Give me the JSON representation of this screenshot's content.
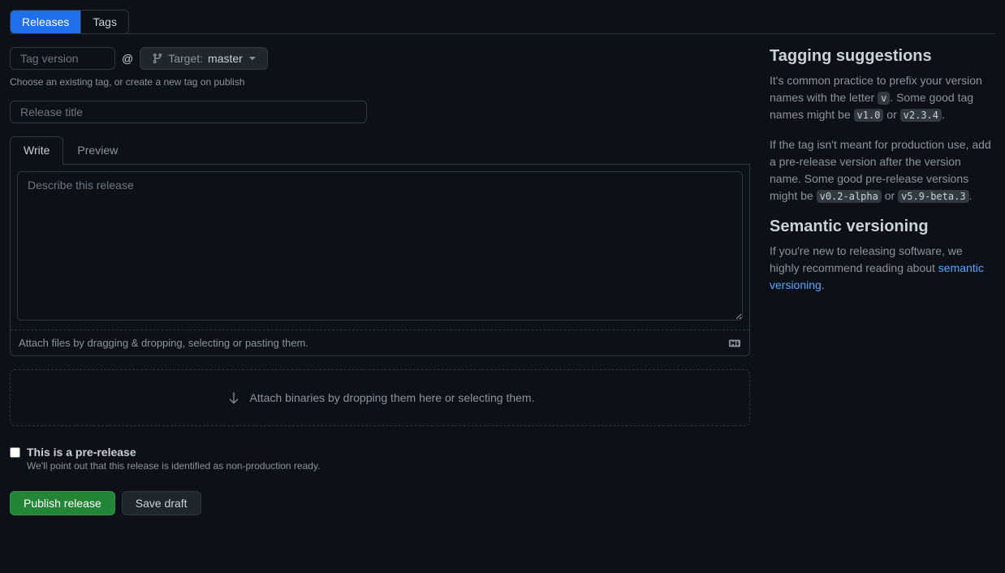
{
  "topTabs": {
    "releases": "Releases",
    "tags": "Tags"
  },
  "tagForm": {
    "tagPlaceholder": "Tag version",
    "at": "@",
    "targetLabel": "Target:",
    "targetBranch": "master",
    "helpText": "Choose an existing tag, or create a new tag on publish",
    "titlePlaceholder": "Release title"
  },
  "editor": {
    "writeTab": "Write",
    "previewTab": "Preview",
    "descPlaceholder": "Describe this release",
    "attachText": "Attach files by dragging & dropping, selecting or pasting them."
  },
  "dropzone": {
    "text": "Attach binaries by dropping them here or selecting them."
  },
  "prerelease": {
    "label": "This is a pre-release",
    "sub": "We'll point out that this release is identified as non-production ready."
  },
  "buttons": {
    "publish": "Publish release",
    "draft": "Save draft"
  },
  "sidebar": {
    "taggingHeading": "Tagging suggestions",
    "taggingP1a": "It's common practice to prefix your version names with the letter ",
    "taggingP1code1": "v",
    "taggingP1b": ". Some good tag names might be ",
    "taggingP1code2": "v1.0",
    "taggingP1c": " or ",
    "taggingP1code3": "v2.3.4",
    "taggingP1d": ".",
    "taggingP2a": "If the tag isn't meant for production use, add a pre-release version after the version name. Some good pre-release versions might be ",
    "taggingP2code1": "v0.2-alpha",
    "taggingP2b": " or ",
    "taggingP2code2": "v5.9-beta.3",
    "taggingP2c": ".",
    "semverHeading": "Semantic versioning",
    "semverP1a": "If you're new to releasing software, we highly recommend reading about ",
    "semverLink": "semantic versioning",
    "semverP1b": "."
  }
}
